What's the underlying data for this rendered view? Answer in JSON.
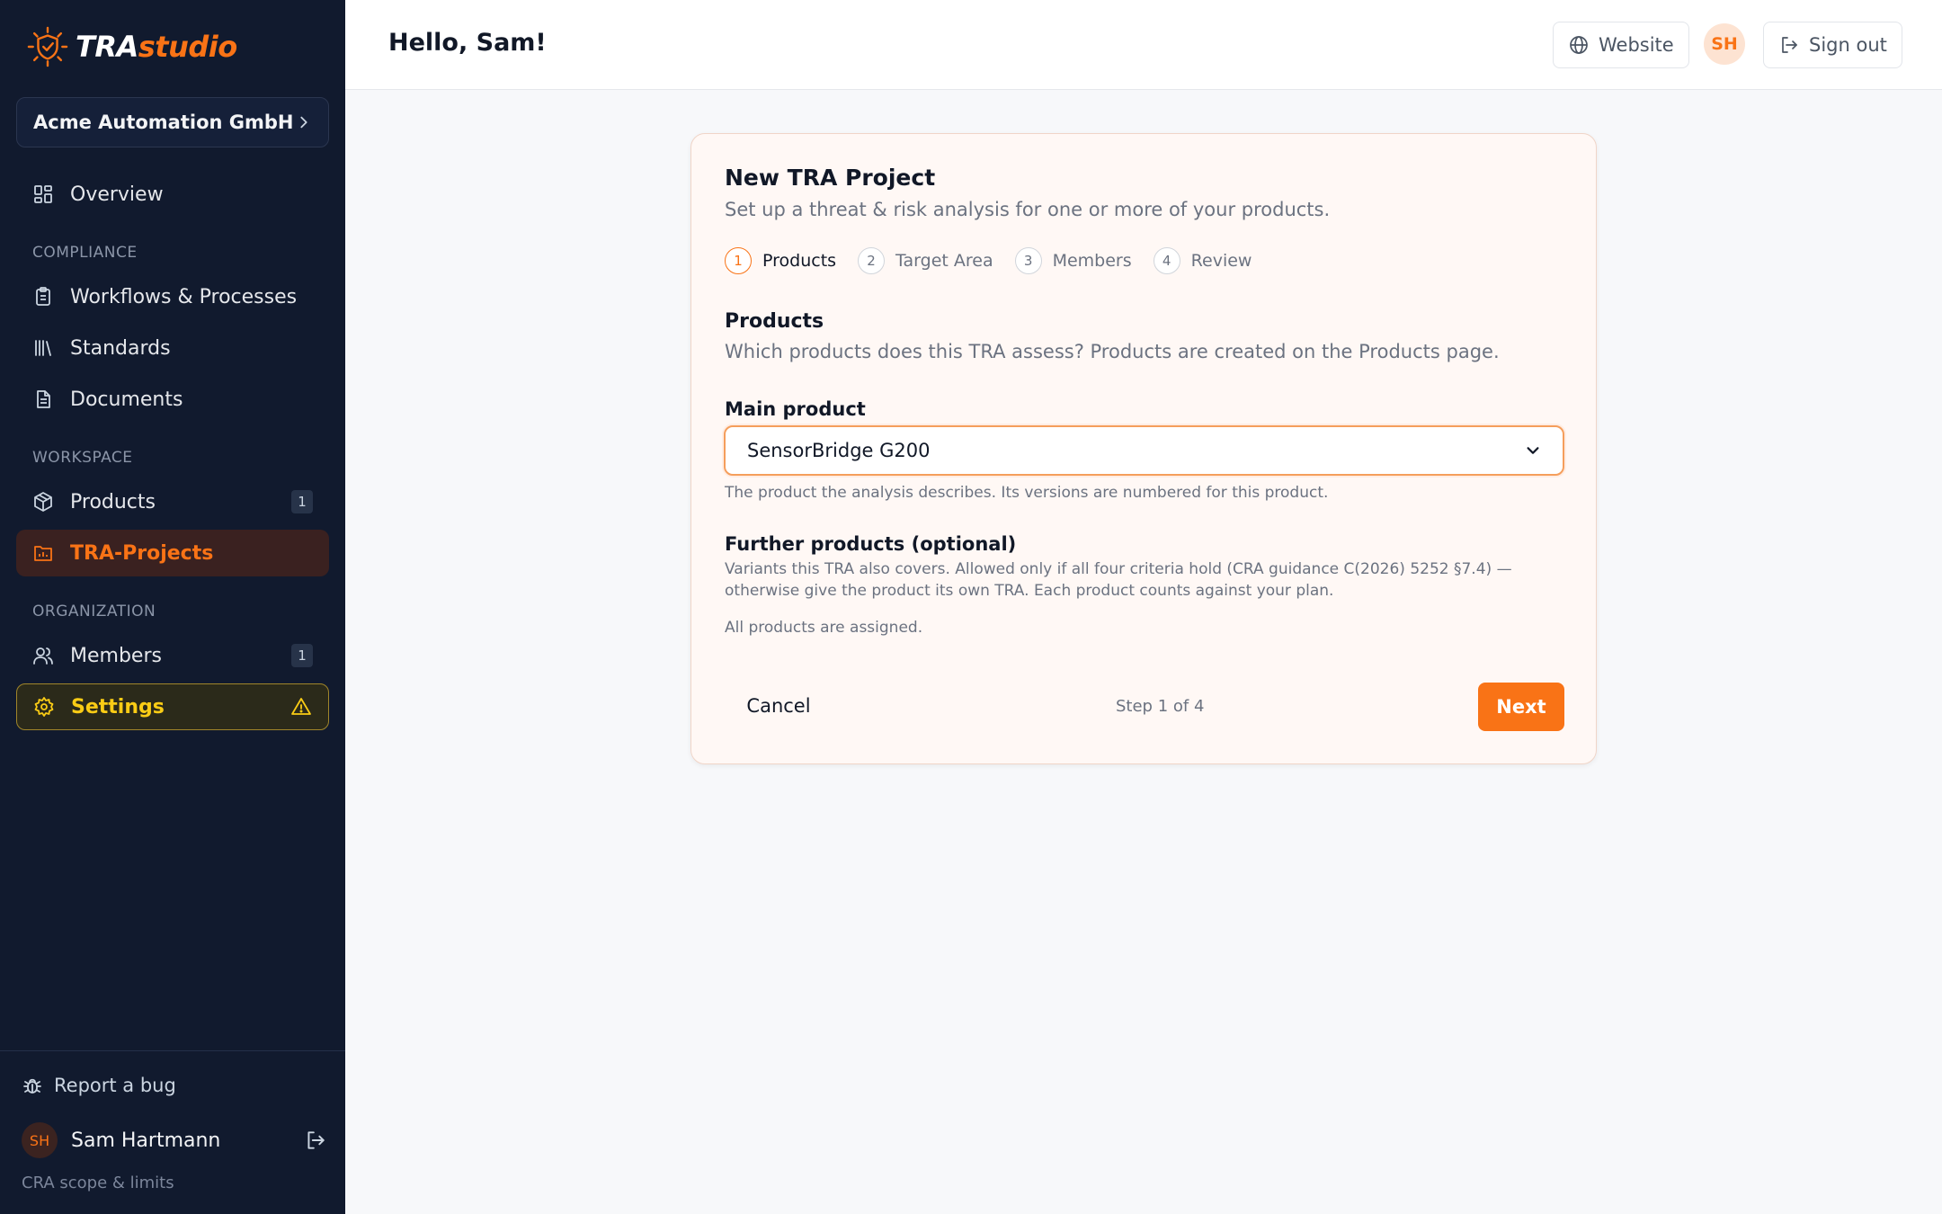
{
  "brand": {
    "name_part1": "TRA",
    "name_part2": "studio",
    "accent": "#f97316"
  },
  "sidebar": {
    "org_name": "Acme Automation GmbH",
    "overview": {
      "label": "Overview",
      "icon": "grid-icon"
    },
    "sections": {
      "compliance": "COMPLIANCE",
      "workspace": "WORKSPACE",
      "organization": "ORGANIZATION"
    },
    "items": {
      "workflows": {
        "label": "Workflows & Processes",
        "icon": "clipboard-icon"
      },
      "standards": {
        "label": "Standards",
        "icon": "library-icon"
      },
      "documents": {
        "label": "Documents",
        "icon": "document-icon"
      },
      "products": {
        "label": "Products",
        "icon": "box-icon",
        "count": "1"
      },
      "tra_projects": {
        "label": "TRA-Projects",
        "icon": "folder-chart-icon",
        "active": true
      },
      "members": {
        "label": "Members",
        "icon": "users-icon",
        "count": "1"
      },
      "settings": {
        "label": "Settings",
        "icon": "gear-icon",
        "warning": true
      }
    },
    "bottom": {
      "report_bug": "Report a bug",
      "user_initials": "SH",
      "user_name": "Sam Hartmann",
      "scope_link": "CRA scope & limits"
    }
  },
  "topbar": {
    "greeting": "Hello, Sam!",
    "website_label": "Website",
    "avatar_initials": "SH",
    "signout_label": "Sign out"
  },
  "wizard": {
    "title": "New TRA Project",
    "subtitle": "Set up a threat & risk analysis for one or more of your products.",
    "steps": [
      {
        "num": "1",
        "label": "Products",
        "current": true
      },
      {
        "num": "2",
        "label": "Target Area"
      },
      {
        "num": "3",
        "label": "Members"
      },
      {
        "num": "4",
        "label": "Review"
      }
    ],
    "section_title": "Products",
    "section_desc": "Which products does this TRA assess? Products are created on the Products page.",
    "main_product_label": "Main product",
    "main_product_value": "SensorBridge G200",
    "main_product_help": "The product the analysis describes. Its versions are numbered for this product.",
    "further_title": "Further products (optional)",
    "further_desc": "Variants this TRA also covers. Allowed only if all four criteria hold (CRA guidance C(2026) 5252 §7.4) — otherwise give the product its own TRA. Each product counts against your plan.",
    "assigned_note": "All products are assigned.",
    "cancel_label": "Cancel",
    "step_counter": "Step 1 of 4",
    "next_label": "Next"
  }
}
